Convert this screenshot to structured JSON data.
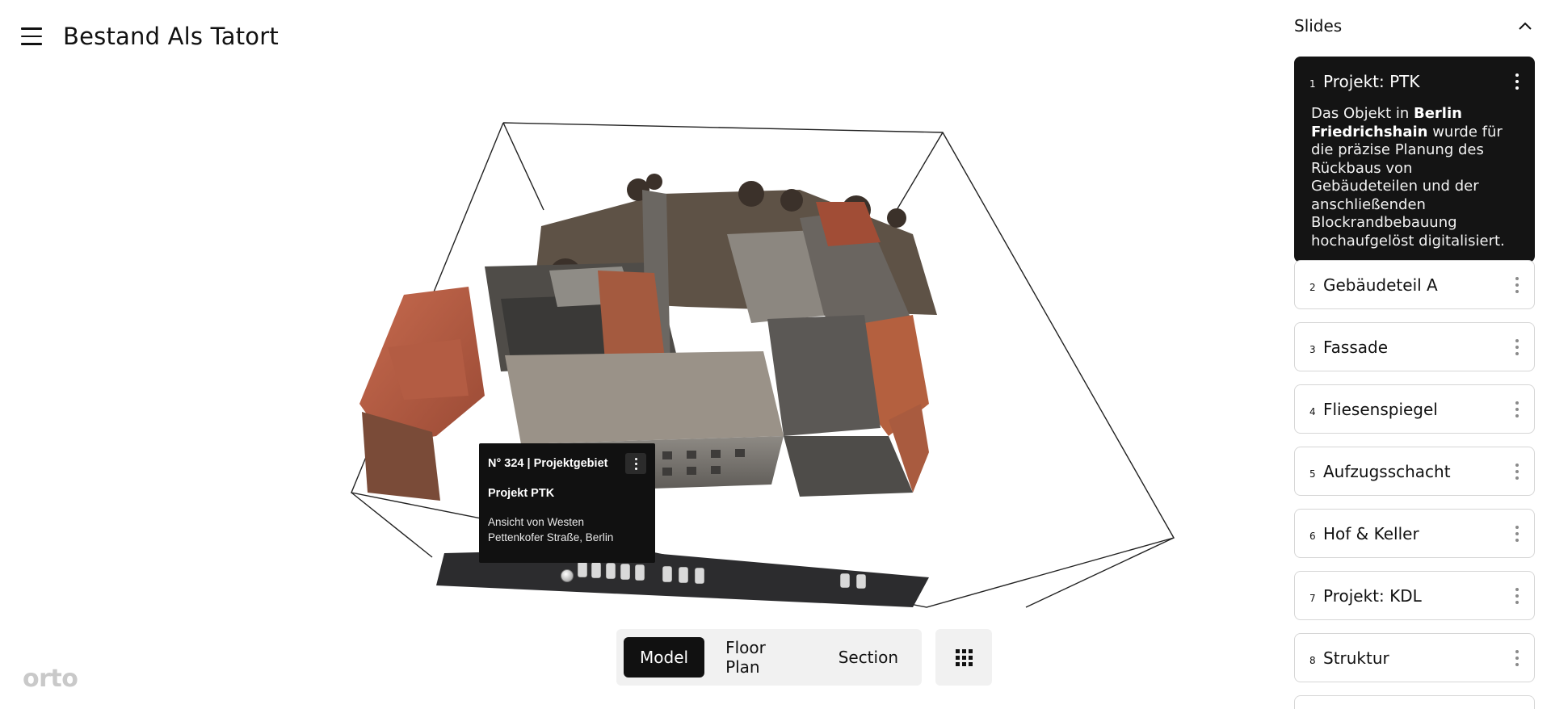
{
  "app": {
    "title": "Bestand Als Tatort",
    "logo": "orto"
  },
  "annotation": {
    "code": "N° 324 | Projektgebiet",
    "title": "Projekt PTK",
    "description_line1": "Ansicht von Westen",
    "description_line2": "Pettenkofer Straße, Berlin"
  },
  "view_switcher": {
    "options": [
      "Model",
      "Floor Plan",
      "Section"
    ],
    "active": "Model"
  },
  "slides": {
    "title": "Slides",
    "items": [
      {
        "num": "1",
        "label": "Projekt: PTK",
        "active": true,
        "desc_pre": "Das Objekt in ",
        "desc_bold": "Berlin Friedrichshain",
        "desc_post": " wurde für die präzise Planung des Rückbaus von Gebäudeteilen und der anschließenden Blockrandbebauung hochaufgelöst digitalisiert."
      },
      {
        "num": "2",
        "label": "Gebäudeteil A"
      },
      {
        "num": "3",
        "label": "Fassade"
      },
      {
        "num": "4",
        "label": "Fliesenspiegel"
      },
      {
        "num": "5",
        "label": "Aufzugsschacht"
      },
      {
        "num": "6",
        "label": "Hof & Keller"
      },
      {
        "num": "7",
        "label": "Projekt: KDL"
      },
      {
        "num": "8",
        "label": "Struktur"
      }
    ]
  },
  "colors": {
    "accent": "#111111",
    "panel_bg": "#f1f1f1",
    "card_border": "#d6d6d6"
  }
}
